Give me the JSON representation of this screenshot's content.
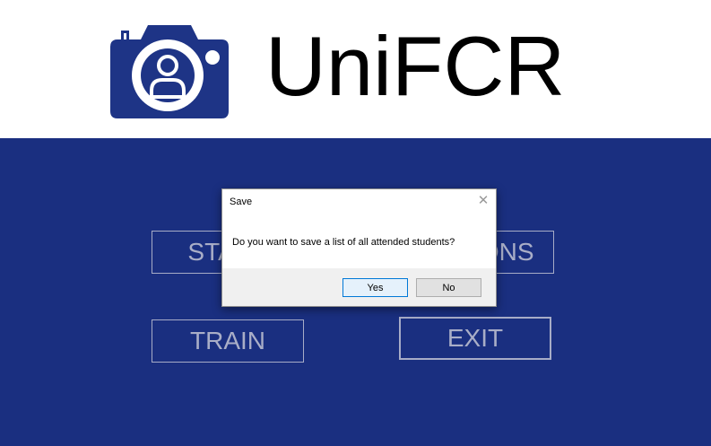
{
  "header": {
    "logo_icon": "camera-user-icon",
    "title": "UniFCR"
  },
  "menu": {
    "start_label": "START",
    "options_label": "OPTIONS",
    "train_label": "TRAIN",
    "exit_label": "EXIT"
  },
  "dialog": {
    "title": "Save",
    "close_icon": "close-icon",
    "message": "Do you want to save a list of all attended students?",
    "yes_label": "Yes",
    "no_label": "No"
  },
  "colors": {
    "background_blue": "#1a2f80",
    "logo_blue": "#1e3486",
    "button_text": "#a9aec7",
    "dialog_default_border": "#0078d7"
  }
}
